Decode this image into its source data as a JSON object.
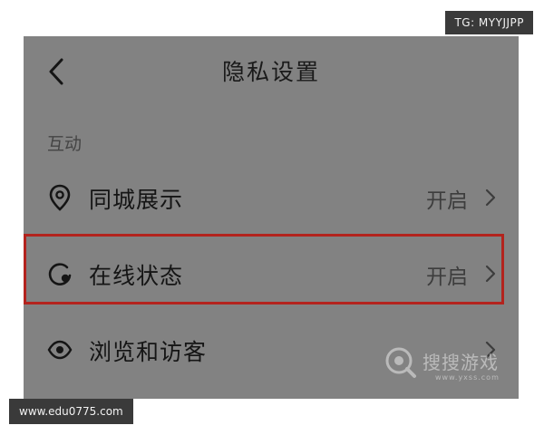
{
  "header": {
    "title": "隐私设置",
    "back_icon": "chevron-left-icon"
  },
  "section": {
    "label": "互动"
  },
  "rows": [
    {
      "label": "同城展示",
      "value": "开启",
      "icon": "location-pin-icon",
      "highlighted": false
    },
    {
      "label": "在线状态",
      "value": "开启",
      "icon": "online-status-icon",
      "highlighted": true
    },
    {
      "label": "浏览和访客",
      "value": "",
      "icon": "eye-icon",
      "highlighted": false
    }
  ],
  "overlays": {
    "tg_badge": "TG: MYYJJPP",
    "url_badge": "www.edu0775.com",
    "watermark_text": "搜搜游戏",
    "watermark_sub": "www.yxss.com"
  },
  "colors": {
    "screen_bg": "#828282",
    "highlight_border": "#b3231d",
    "badge_bg": "#3a3a3a"
  }
}
